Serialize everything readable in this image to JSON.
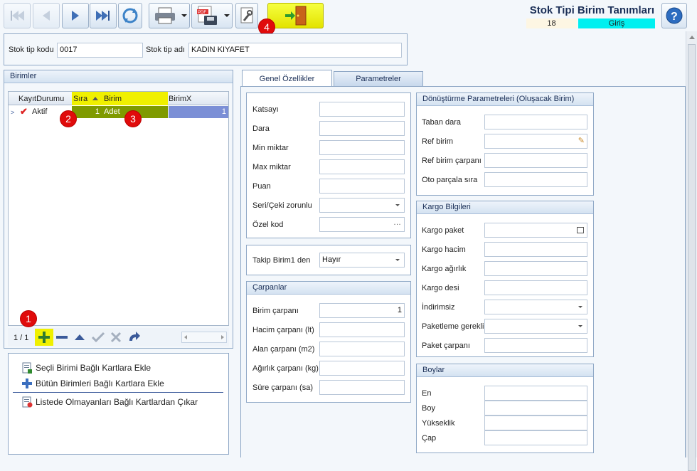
{
  "header": {
    "title": "Stok Tipi Birim Tanımları",
    "record_no": "18",
    "mode": "Giriş"
  },
  "toolbar": {
    "badge": "4"
  },
  "form": {
    "code_label": "Stok tip kodu",
    "code_value": "0017",
    "name_label": "Stok tip adı",
    "name_value": "KADIN KIYAFET"
  },
  "birimler": {
    "title": "Birimler",
    "columns": [
      "KayıtDurumu",
      "Sıra",
      "Birim",
      "BirimX"
    ],
    "row": {
      "status": "Aktif",
      "sira": "1",
      "birim": "Adet",
      "birimx": "1"
    },
    "pager": "1 / 1",
    "badges": [
      "1",
      "2",
      "3"
    ]
  },
  "actions": [
    "Seçli Birimi Bağlı Kartlara Ekle",
    "Bütün Birimleri Bağlı Kartlara Ekle",
    "Listede Olmayanları Bağlı Kartlardan Çıkar"
  ],
  "tabs": [
    "Genel Özellikler",
    "Parametreler"
  ],
  "general": {
    "katsayi": "Katsayı",
    "dara": "Dara",
    "min": "Min miktar",
    "max": "Max miktar",
    "puan": "Puan",
    "seri": "Seri/Çeki zorunlu",
    "ozel": "Özel kod",
    "takip_label": "Takip Birim1 den",
    "takip_value": "Hayır"
  },
  "carpanlar": {
    "title": "Çarpanlar",
    "birim": "Birim çarpanı",
    "birim_value": "1",
    "hacim": "Hacim çarpanı (lt)",
    "alan": "Alan çarpanı (m2)",
    "agirlik": "Ağırlık çarpanı (kg)",
    "sure": "Süre çarpanı (sa)"
  },
  "donusturme": {
    "title": "Dönüştürme Parametreleri (Oluşacak Birim)",
    "taban": "Taban dara",
    "ref": "Ref birim",
    "refc": "Ref birim çarpanı",
    "oto": "Oto parçala sıra"
  },
  "kargo": {
    "title": "Kargo Bilgileri",
    "paket": "Kargo paket",
    "hacim": "Kargo hacim",
    "agirlik": "Kargo ağırlık",
    "desi": "Kargo desi",
    "indirimsiz": "İndirimsiz",
    "paketleme": "Paketleme gerekli",
    "carpan": "Paket çarpanı"
  },
  "boylar": {
    "title": "Boylar",
    "en": "En",
    "boy": "Boy",
    "yuk": "Yükseklik",
    "cap": "Çap"
  },
  "colors": {
    "accent": "#1b2f57",
    "mode_bg": "#00f0f0",
    "yellow": "#f0f000",
    "grid_sel": "#7f9a00"
  }
}
